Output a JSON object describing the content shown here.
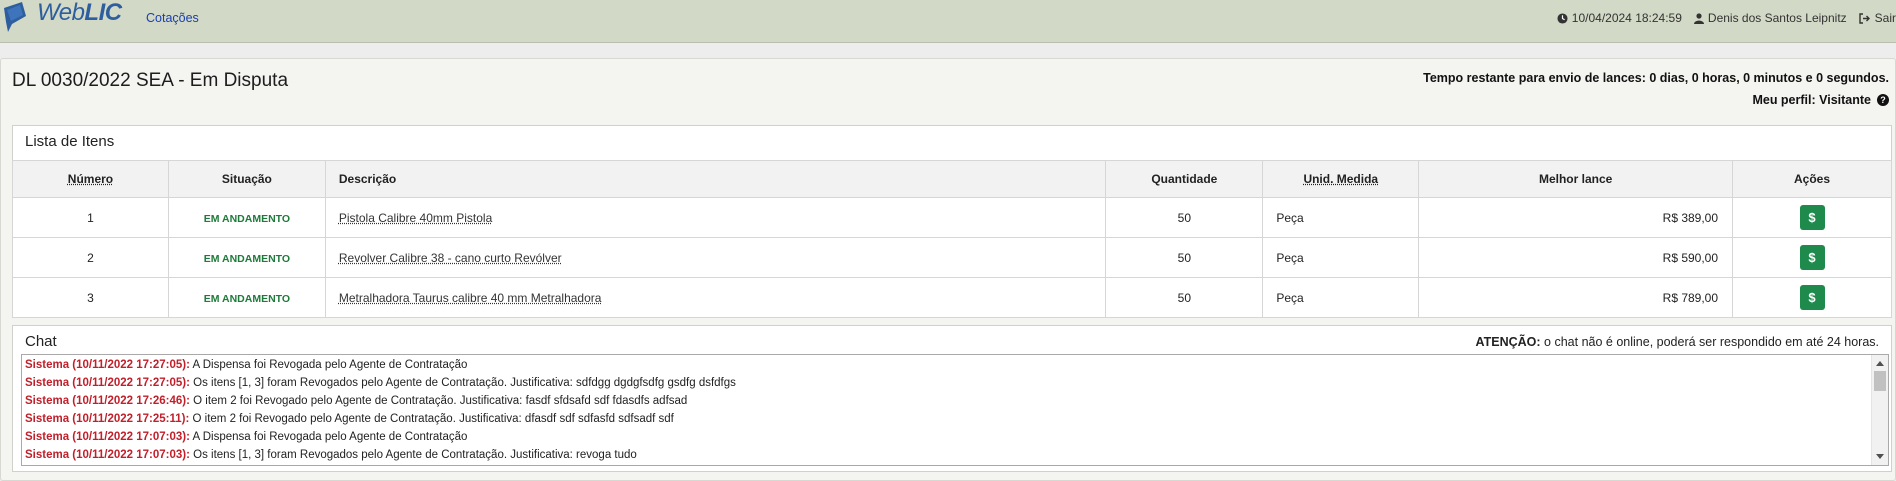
{
  "brand": {
    "name_light": "Web",
    "name_bold": "LIC",
    "color": "#2f5e9e"
  },
  "nav": {
    "cotacoes": "Cotações"
  },
  "header": {
    "datetime": "10/04/2024 18:24:59",
    "user": "Denis dos Santos Leipnitz",
    "logout": "Sair"
  },
  "page": {
    "title": "DL 0030/2022 SEA - Em Disputa",
    "timer": "Tempo restante para envio de lances: 0 dias, 0 horas, 0 minutos e 0 segundos.",
    "perfil": "Meu perfil: Visitante"
  },
  "items": {
    "title": "Lista de Itens",
    "headers": {
      "numero": "Número",
      "situacao": "Situação",
      "descricao": "Descrição",
      "quantidade": "Quantidade",
      "unidade": "Unid. Medida",
      "melhor_lance": "Melhor lance",
      "acoes": "Ações"
    },
    "rows": [
      {
        "numero": "1",
        "situacao": "EM ANDAMENTO",
        "descricao": "Pistola Calibre 40mm Pistola",
        "quantidade": "50",
        "unidade": "Peça",
        "melhor_lance": "R$ 389,00",
        "acao": "$"
      },
      {
        "numero": "2",
        "situacao": "EM ANDAMENTO",
        "descricao": "Revolver Calibre 38 - cano curto Revólver",
        "quantidade": "50",
        "unidade": "Peça",
        "melhor_lance": "R$ 590,00",
        "acao": "$"
      },
      {
        "numero": "3",
        "situacao": "EM ANDAMENTO",
        "descricao": "Metralhadora Taurus calibre 40 mm Metralhadora",
        "quantidade": "50",
        "unidade": "Peça",
        "melhor_lance": "R$ 789,00",
        "acao": "$"
      }
    ]
  },
  "chat": {
    "title": "Chat",
    "notice_label": "ATENÇÃO:",
    "notice_text": " o chat não é online, poderá ser respondido em até 24 horas.",
    "messages": [
      {
        "who": "Sistema (10/11/2022 17:27:05):",
        "text": " A Dispensa foi Revogada pelo Agente de Contratação"
      },
      {
        "who": "Sistema (10/11/2022 17:27:05):",
        "text": " Os itens [1, 3] foram Revogados pelo Agente de Contratação. Justificativa: sdfdgg dgdgfsdfg gsdfg dsfdfgs"
      },
      {
        "who": "Sistema (10/11/2022 17:26:46):",
        "text": " O item 2 foi Revogado pelo Agente de Contratação. Justificativa: fasdf sfdsafd sdf fdasdfs adfsad"
      },
      {
        "who": "Sistema (10/11/2022 17:25:11):",
        "text": " O item 2 foi Revogado pelo Agente de Contratação. Justificativa: dfasdf sdf sdfasfd sdfsadf sdf"
      },
      {
        "who": "Sistema (10/11/2022 17:07:03):",
        "text": " A Dispensa foi Revogada pelo Agente de Contratação"
      },
      {
        "who": "Sistema (10/11/2022 17:07:03):",
        "text": " Os itens [1, 3] foram Revogados pelo Agente de Contratação. Justificativa: revoga tudo"
      }
    ]
  },
  "colors": {
    "status_green": "#1e7a3a",
    "action_green": "#1e8a4c",
    "system_red": "#c11f2a",
    "topbar": "#d2d9c6"
  }
}
